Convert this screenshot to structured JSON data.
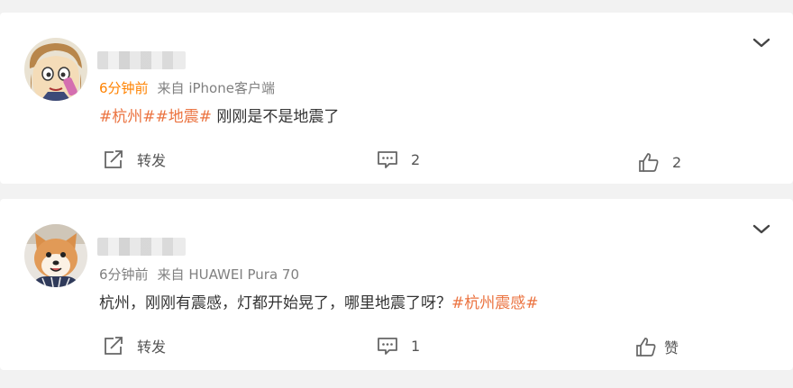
{
  "feed": {
    "posts": [
      {
        "avatar_icon": "cartoon-avatar",
        "time": "6分钟前",
        "time_color": "#ff8200",
        "source": "来自 iPhone客户端",
        "tags": [
          "#杭州#",
          "#地震#"
        ],
        "text_after_tags": " 刚刚是不是地震了",
        "actions": {
          "repost_label": "转发",
          "comment_count": "2",
          "like_label": "2"
        }
      },
      {
        "avatar_icon": "shiba-dog-avatar",
        "time": "6分钟前",
        "time_color": "#808080",
        "source": "来自 HUAWEI Pura 70",
        "text_before_tag": "杭州，刚刚有震感，灯都开始晃了，哪里地震了呀？",
        "tag": "#杭州震感#",
        "actions": {
          "repost_label": "转发",
          "comment_count": "1",
          "like_label": "赞"
        }
      }
    ]
  },
  "colors": {
    "accent": "#ff8200",
    "tag": "#eb7340",
    "meta": "#808080"
  }
}
